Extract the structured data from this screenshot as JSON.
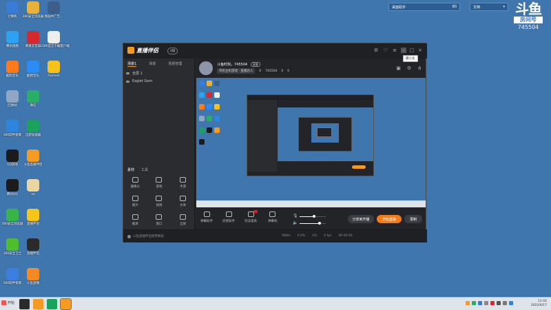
{
  "desktop_icons": [
    {
      "label": "计算机",
      "color": "#3a7bd5"
    },
    {
      "label": "360安全浏览器",
      "color": "#e8b23a"
    },
    {
      "label": "我画中广告...",
      "color": "#3c5f8a"
    },
    {
      "label": "腾讯视频",
      "color": "#2ba3f2"
    },
    {
      "label": "网易云音乐",
      "color": "#d5282f"
    },
    {
      "label": "12306官方下载客户端",
      "color": "#eeeeee"
    },
    {
      "label": "酷狗音乐",
      "color": "#ff7a1a"
    },
    {
      "label": "酷我音乐",
      "color": "#2a8cf5"
    },
    {
      "label": "Foxmail",
      "color": "#f7c21b"
    },
    {
      "label": "回收站",
      "color": "#8fa7c2"
    },
    {
      "label": "微信",
      "color": "#2aae67"
    },
    {
      "label": "360软件管家",
      "color": "#2d85e0"
    },
    {
      "label": "迅游加速器",
      "color": "#1aa35c"
    },
    {
      "label": "QQ游戏",
      "color": "#1b1b1b"
    },
    {
      "label": "斗鱼直播伴侣",
      "color": "#f59a23"
    },
    {
      "label": "腾讯QQ",
      "color": "#1b1b1b"
    },
    {
      "label": "aa",
      "color": "#e9d6a2"
    },
    {
      "label": "360安全浏览器",
      "color": "#37b549"
    },
    {
      "label": "直播伴侣",
      "color": "#f5c518"
    },
    {
      "label": "360安全卫士",
      "color": "#4fbe2e"
    },
    {
      "label": "直播伴侣",
      "color": "#2a2a2a"
    },
    {
      "label": "360软件管家",
      "color": "#3b7ee0"
    },
    {
      "label": "斗鱼直播",
      "color": "#f58a23"
    }
  ],
  "widgets": {
    "scene_label": "桌面助手",
    "scene_value": "80",
    "other_label": "文档"
  },
  "brand": {
    "logo": "斗鱼",
    "sub": "房间号",
    "room_number": "745504"
  },
  "app": {
    "title": "直播伴侣",
    "tag": "4级",
    "tooltip": "最小化",
    "left_tabs": [
      "场景1",
      "场景",
      "场景管理"
    ],
    "scenes": [
      "全屏 1",
      "Eaglet Gem"
    ],
    "source_tabs": [
      "素材",
      "工具"
    ],
    "sources": [
      "摄像头",
      "游戏",
      "手游",
      "图片",
      "视频",
      "文本",
      "截屏",
      "窗口",
      "全屏"
    ],
    "streamer_name": "斗鱼时刻，745504",
    "live_tag": "直播",
    "category": "单机主机游戏 · 直播达人",
    "viewer_icon_count": "0",
    "followers": "745504",
    "hot": "0",
    "likes": "0",
    "controls": [
      "弹幕助手",
      "房管助手",
      "玩法道具",
      "弹幕机"
    ],
    "btn_share": "分享到开播",
    "btn_start": "开始直播",
    "btn_record": "录制",
    "status_tip": "斗鱼直播伴侣使用教程",
    "stats": [
      "0KB/s",
      "0.0%",
      "0%",
      "0 fps",
      "00:00:00"
    ]
  },
  "taskbar": {
    "start_label": "开始",
    "time": "11:02",
    "date": "2022/6/17",
    "items": [
      {
        "color": "#2a2a2a"
      },
      {
        "color": "#f59a23"
      },
      {
        "color": "#1aa35c"
      },
      {
        "color": "#f59a23"
      }
    ]
  }
}
